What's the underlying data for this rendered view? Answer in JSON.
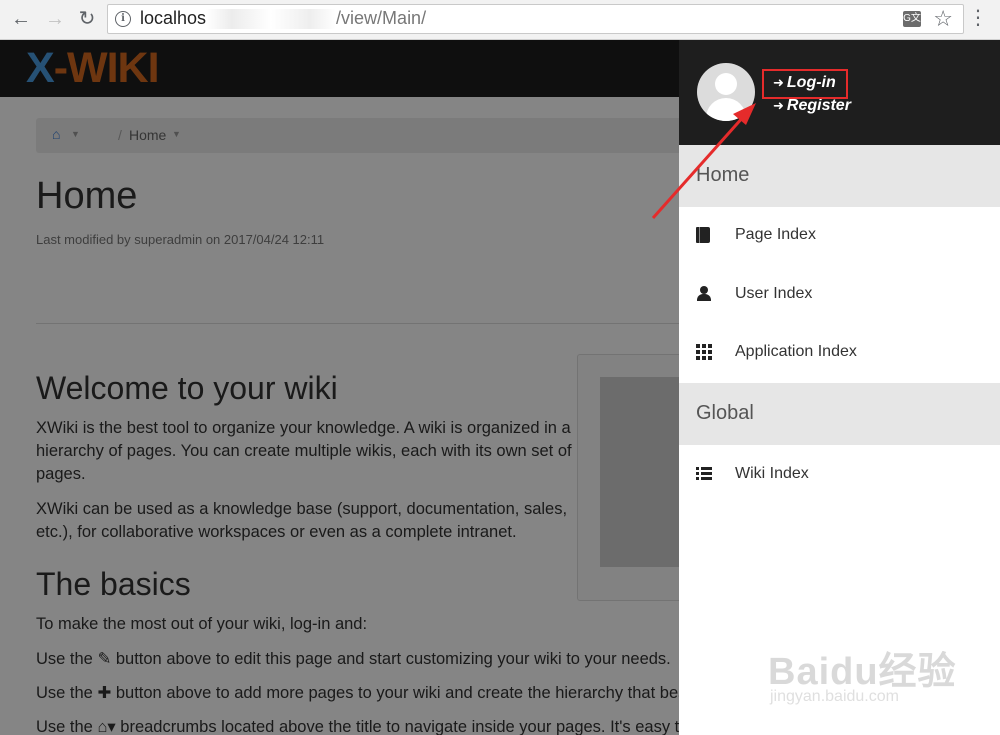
{
  "browser": {
    "url_host": "localhos",
    "url_path": "/view/Main/",
    "translate_label": "G文"
  },
  "wiki": {
    "logo": {
      "x": "X",
      "rest": "-WIKI"
    },
    "breadcrumb": {
      "home_label": "Home"
    },
    "title": "Home",
    "meta": "Last modified by superadmin on 2017/04/24 12:11",
    "welcome_heading": "Welcome to your wiki",
    "welcome_p1": "XWiki is the best tool to organize your knowledge. A wiki is organized in a hierarchy of pages. You can create multiple wikis, each with its own set of pages.",
    "welcome_p2": "XWiki can be used as a knowledge base (support, documentation, sales, etc.), for collaborative workspaces or even as a complete intranet.",
    "basics_heading": "The basics",
    "basics_p1": "To make the most out of your wiki, log-in and:",
    "basics_p2": "Use the ✎ button above to edit this page and start customizing your wiki to your needs.",
    "basics_p3": "Use the ✚ button above to add more pages to your wiki and create the hierarchy that best",
    "basics_p4": "Use the ⌂▾ breadcrumbs located above the title to navigate inside your pages. It's easy to"
  },
  "drawer": {
    "login_label": "Log-in",
    "register_label": "Register",
    "sections": [
      {
        "heading": "Home",
        "items": [
          {
            "label": "Page Index",
            "icon": "book-icon"
          },
          {
            "label": "User Index",
            "icon": "user-icon"
          },
          {
            "label": "Application Index",
            "icon": "grid-icon"
          }
        ]
      },
      {
        "heading": "Global",
        "items": [
          {
            "label": "Wiki Index",
            "icon": "list-icon"
          }
        ]
      }
    ]
  },
  "watermark": {
    "main": "Baidu经验",
    "sub": "jingyan.baidu.com"
  },
  "colors": {
    "accent_red": "#e52b2b",
    "logo_orange": "#d4691f",
    "logo_blue": "#4a9be0"
  }
}
